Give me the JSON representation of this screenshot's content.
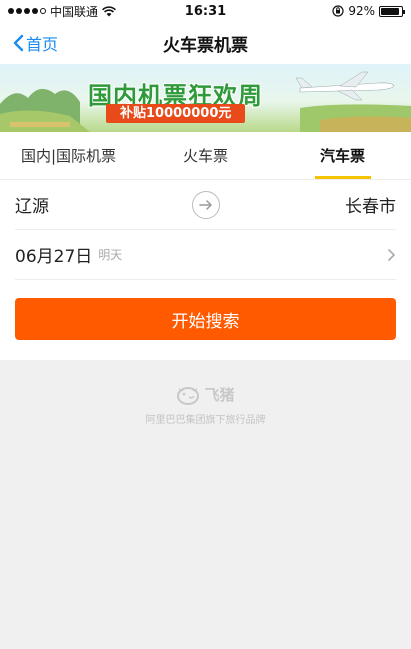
{
  "status_bar": {
    "carrier": "中国联通",
    "time": "16:31",
    "battery": "92%",
    "battery_level": 0.92
  },
  "nav": {
    "back_label": "首页",
    "title": "火车票机票"
  },
  "banner": {
    "title": "国内机票狂欢周",
    "subtitle": "补贴10000000元"
  },
  "tabs": [
    {
      "label": "国内|国际机票",
      "active": false
    },
    {
      "label": "火车票",
      "active": false
    },
    {
      "label": "汽车票",
      "active": true
    }
  ],
  "form": {
    "from_city": "辽源",
    "to_city": "长春市",
    "date": "06月27日",
    "date_hint": "明天",
    "search_label": "开始搜索"
  },
  "brand": {
    "name": "飞猪",
    "tagline": "阿里巴巴集团旗下旅行品牌"
  },
  "colors": {
    "accent": "#ff5a00",
    "nav_link": "#1a8cf0",
    "tab_indicator": "#f5c400"
  }
}
